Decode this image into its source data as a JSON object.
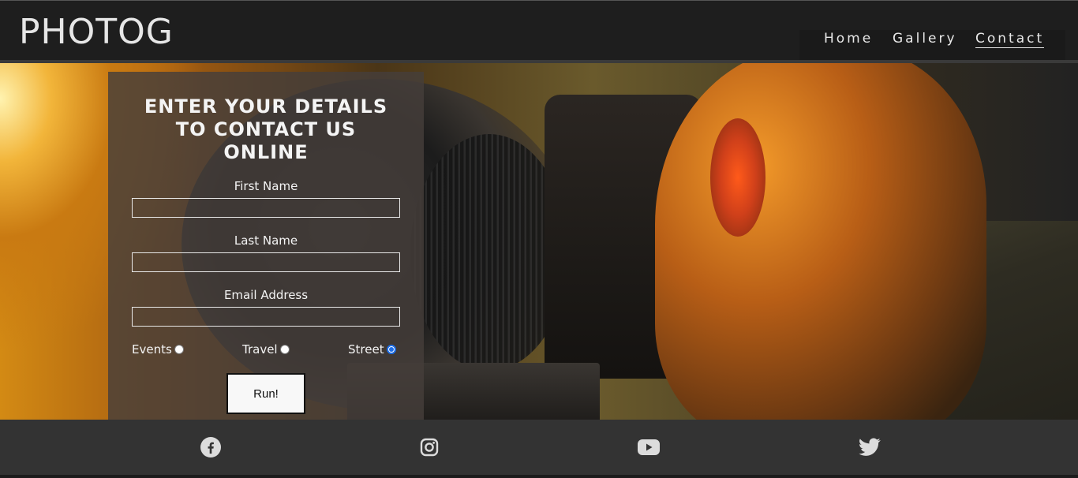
{
  "brand": {
    "name": "PHOTOG"
  },
  "nav": {
    "items": [
      {
        "label": "Home"
      },
      {
        "label": "Gallery"
      },
      {
        "label": "Contact"
      }
    ],
    "active": "Contact"
  },
  "hero": {
    "image": "photographer-with-camera"
  },
  "form": {
    "title": "Enter your details to contact us online",
    "fields": [
      {
        "label": "First Name",
        "value": ""
      },
      {
        "label": "Last Name",
        "value": ""
      },
      {
        "label": "Email Address",
        "value": ""
      }
    ],
    "radios": [
      {
        "label": "Events",
        "checked": false
      },
      {
        "label": "Travel",
        "checked": false
      },
      {
        "label": "Street",
        "checked": true
      }
    ],
    "submit_label": "Run!"
  },
  "footer": {
    "icons": [
      "facebook-icon",
      "instagram-icon",
      "youtube-icon",
      "twitter-icon"
    ]
  },
  "colors": {
    "navbar": "#1e1e1e",
    "footer": "#333333",
    "radio_checked": "#1d6ee8"
  }
}
